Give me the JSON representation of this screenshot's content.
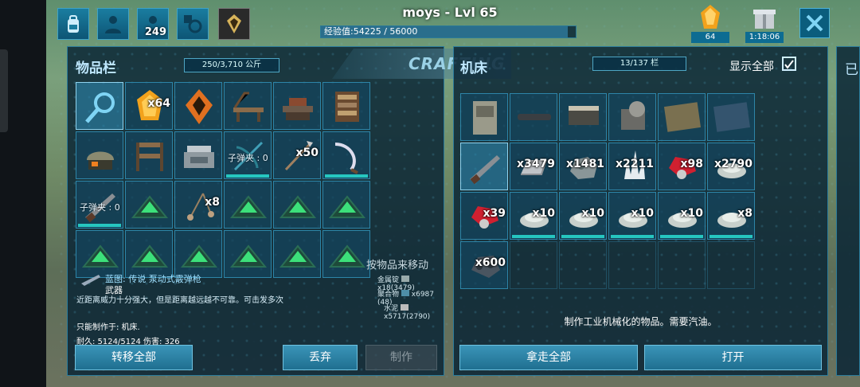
{
  "hud": {
    "player_name": "moys - Lvl 65",
    "xp_label": "经验值:54225 / 56000",
    "xp_fraction": 0.968,
    "tribe_count": "249",
    "element_count": "64",
    "timer": "1:18:06"
  },
  "inventory": {
    "title": "物品栏",
    "weight": "250/3,710 公斤",
    "crafting_tab": "CRAFTING",
    "slots": [
      {
        "icon": "magnifier-icon",
        "qty": "",
        "cap": ""
      },
      {
        "icon": "element-icon",
        "qty": "x64",
        "cap": ""
      },
      {
        "icon": "artifact-icon",
        "qty": "",
        "cap": ""
      },
      {
        "icon": "crafting-bench-icon",
        "qty": "",
        "cap": ""
      },
      {
        "icon": "smithy-icon",
        "qty": "",
        "cap": ""
      },
      {
        "icon": "bookshelf-icon",
        "qty": "",
        "cap": ""
      },
      {
        "icon": "helmet-icon",
        "qty": "",
        "cap": ""
      },
      {
        "icon": "table-icon",
        "qty": "",
        "cap": ""
      },
      {
        "icon": "fabricator-icon",
        "qty": "",
        "cap": ""
      },
      {
        "icon": "crossbow-icon",
        "qty": "",
        "cap": "子弹夹 : 0",
        "bar": true
      },
      {
        "icon": "spear-icon",
        "qty": "x50",
        "cap": ""
      },
      {
        "icon": "sickle-icon",
        "qty": "",
        "cap": "",
        "bar": true
      },
      {
        "icon": "shotgun-icon",
        "qty": "",
        "cap": "子弹夹 : 0",
        "bar": true
      },
      {
        "icon": "trap-icon",
        "qty": "",
        "cap": ""
      },
      {
        "icon": "bola-icon",
        "qty": "x8",
        "cap": ""
      },
      {
        "icon": "trap-icon",
        "qty": "",
        "cap": ""
      },
      {
        "icon": "trap-icon",
        "qty": "",
        "cap": ""
      },
      {
        "icon": "trap-icon",
        "qty": "",
        "cap": ""
      },
      {
        "icon": "trap-icon",
        "qty": "",
        "cap": ""
      },
      {
        "icon": "trap-icon",
        "qty": "",
        "cap": ""
      },
      {
        "icon": "trap-icon",
        "qty": "",
        "cap": ""
      },
      {
        "icon": "trap-icon",
        "qty": "",
        "cap": ""
      },
      {
        "icon": "trap-icon",
        "qty": "",
        "cap": ""
      },
      {
        "icon": "trap-icon",
        "qty": "",
        "cap": ""
      }
    ],
    "info": {
      "blueprint": "蓝图: 传说 泵动式霰弹枪",
      "category": "武器",
      "desc": "近距离威力十分强大，但是距离越远越不可靠。可击发多次",
      "craft_only": "只能制作于: 机床.",
      "stats": "耐久: 5124/5124 伤害: 326",
      "move_hint": "按物品来移动",
      "materials": [
        {
          "name": "金属锭",
          "amount": "x18(3479)"
        },
        {
          "name": "聚合物",
          "amount": "x6987 (48)"
        },
        {
          "name": "水泥",
          "amount": "x5717(2790)"
        }
      ]
    },
    "buttons": {
      "transfer_all": "转移全部",
      "drop": "丢弃",
      "craft": "制作"
    }
  },
  "machine": {
    "title": "机床",
    "capacity": "13/137 栏",
    "show_all": "显示全部",
    "show_all_checked": true,
    "slots": [
      {
        "icon": "cabinet-icon",
        "qty": ""
      },
      {
        "icon": "rod-icon",
        "qty": ""
      },
      {
        "icon": "box-icon",
        "qty": ""
      },
      {
        "icon": "generator-icon",
        "qty": ""
      },
      {
        "icon": "board-icon",
        "qty": ""
      },
      {
        "icon": "panel-icon",
        "qty": ""
      },
      {
        "icon": "shotgun-icon",
        "qty": ""
      },
      {
        "icon": "ingot-icon",
        "qty": "x3479"
      },
      {
        "icon": "ore-icon",
        "qty": "x1481"
      },
      {
        "icon": "crystal-icon",
        "qty": "x2211"
      },
      {
        "icon": "polymer-icon",
        "qty": "x98"
      },
      {
        "icon": "cement-icon",
        "qty": "x2790"
      },
      {
        "icon": "polymer-icon",
        "qty": "x39"
      },
      {
        "icon": "cement-icon",
        "qty": "x10",
        "bar": true
      },
      {
        "icon": "cement-icon",
        "qty": "x10",
        "bar": true
      },
      {
        "icon": "cement-icon",
        "qty": "x10",
        "bar": true
      },
      {
        "icon": "cement-icon",
        "qty": "x10",
        "bar": true
      },
      {
        "icon": "cement-icon",
        "qty": "x8",
        "bar": true
      },
      {
        "icon": "stone-icon",
        "qty": "x600"
      }
    ],
    "desc": "制作工业机械化的物品。需要汽油。",
    "buttons": {
      "take_all": "拿走全部",
      "open": "打开"
    }
  },
  "side_panel_label": "已"
}
